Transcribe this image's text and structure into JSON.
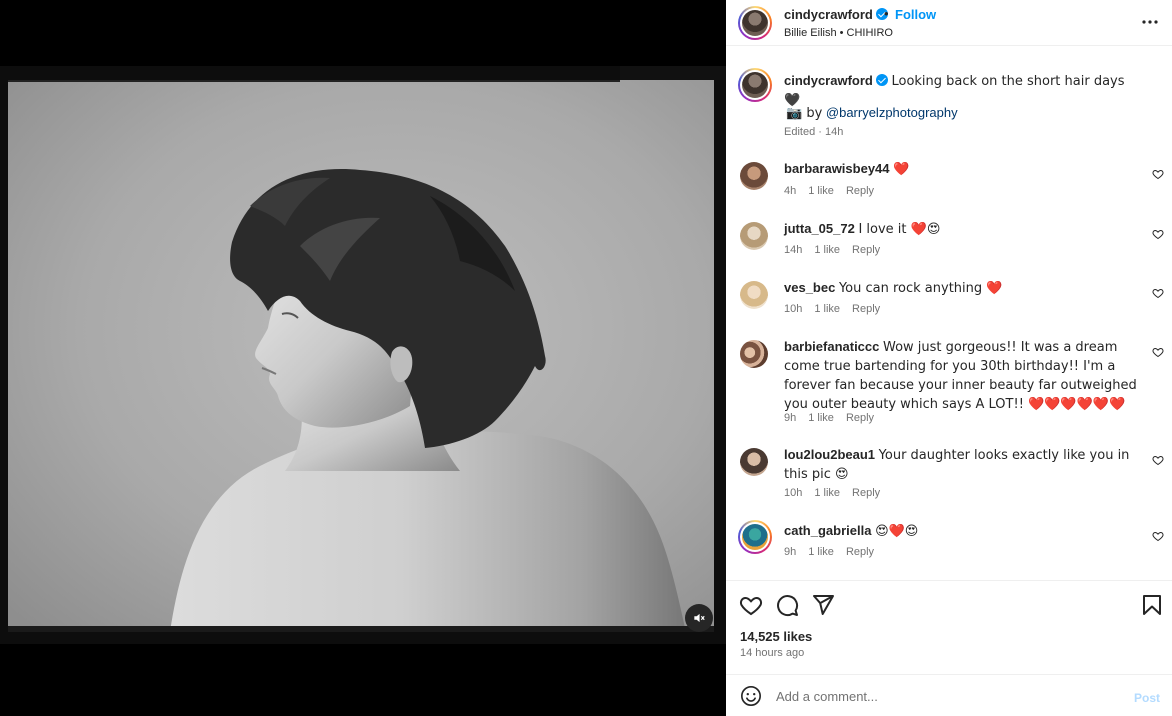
{
  "post": {
    "username": "cindycrawford",
    "follow_label": "Follow",
    "separator": "•",
    "audio": "Billie Eilish • CHIHIRO",
    "caption_text": "Looking back on the short hair days 🖤",
    "credit_prefix": "📷 by",
    "credit_mention": "@barryelzphotography",
    "edited": "Edited · 14h",
    "likes": "14,525 likes",
    "posted_ago": "14 hours ago"
  },
  "comments": [
    {
      "user": "barbarawisbey44",
      "text": "❤️",
      "time": "4h",
      "likes": "1 like",
      "reply": "Reply"
    },
    {
      "user": "jutta_05_72",
      "text": "I love it ❤️😍",
      "time": "14h",
      "likes": "1 like",
      "reply": "Reply"
    },
    {
      "user": "ves_bec",
      "text": "You can rock anything ❤️",
      "time": "10h",
      "likes": "1 like",
      "reply": "Reply"
    },
    {
      "user": "barbiefanaticcc",
      "text": "Wow just gorgeous!! It was a dream come true bartending for you 30th birthday!! I'm a forever fan because your inner beauty far outweighed you outer beauty which says A LOT!! ❤️❤️❤️❤️❤️❤️",
      "time": "9h",
      "likes": "1 like",
      "reply": "Reply"
    },
    {
      "user": "lou2lou2beau1",
      "text": "Your daughter looks exactly like you in this pic 😍",
      "time": "10h",
      "likes": "1 like",
      "reply": "Reply"
    },
    {
      "user": "cath_gabriella",
      "text": "😍❤️😍",
      "time": "9h",
      "likes": "1 like",
      "reply": "Reply"
    }
  ],
  "add_comment": {
    "placeholder": "Add a comment...",
    "post_label": "Post"
  },
  "colors": {
    "accent": "#0095f6",
    "heart": "#ed4956",
    "muted_text": "#737373"
  }
}
